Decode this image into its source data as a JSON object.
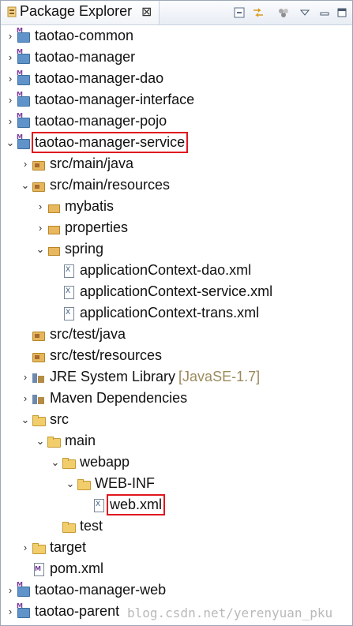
{
  "view": {
    "title": "Package Explorer",
    "close_glyph": "⊠"
  },
  "toolbar": {
    "icons": [
      "collapse-all-icon",
      "link-with-editor-icon",
      "focus-icon",
      "view-menu-icon",
      "minimize-icon",
      "maximize-icon"
    ]
  },
  "tree": [
    {
      "label": "taotao-common",
      "icon": "maven-project-icon",
      "expanded": false
    },
    {
      "label": "taotao-manager",
      "icon": "maven-project-icon",
      "expanded": false
    },
    {
      "label": "taotao-manager-dao",
      "icon": "maven-project-icon",
      "expanded": false
    },
    {
      "label": "taotao-manager-interface",
      "icon": "maven-project-icon",
      "expanded": false
    },
    {
      "label": "taotao-manager-pojo",
      "icon": "maven-project-icon",
      "expanded": false
    },
    {
      "label": "taotao-manager-service",
      "icon": "maven-project-icon",
      "expanded": true,
      "highlighted": true
    },
    {
      "label": "src/main/java",
      "icon": "source-folder-icon",
      "expanded": false
    },
    {
      "label": "src/main/resources",
      "icon": "source-folder-icon",
      "expanded": true
    },
    {
      "label": "mybatis",
      "icon": "package-icon",
      "expanded": false
    },
    {
      "label": "properties",
      "icon": "package-icon",
      "expanded": false
    },
    {
      "label": "spring",
      "icon": "package-icon",
      "expanded": true
    },
    {
      "label": "applicationContext-dao.xml",
      "icon": "xml-file-icon"
    },
    {
      "label": "applicationContext-service.xml",
      "icon": "xml-file-icon"
    },
    {
      "label": "applicationContext-trans.xml",
      "icon": "xml-file-icon"
    },
    {
      "label": "src/test/java",
      "icon": "source-folder-icon"
    },
    {
      "label": "src/test/resources",
      "icon": "source-folder-icon"
    },
    {
      "label": "JRE System Library",
      "decoration": "[JavaSE-1.7]",
      "icon": "library-icon",
      "expanded": false
    },
    {
      "label": "Maven Dependencies",
      "icon": "library-icon",
      "expanded": false
    },
    {
      "label": "src",
      "icon": "folder-icon",
      "expanded": true
    },
    {
      "label": "main",
      "icon": "folder-icon",
      "expanded": true
    },
    {
      "label": "webapp",
      "icon": "folder-icon",
      "expanded": true
    },
    {
      "label": "WEB-INF",
      "icon": "folder-icon",
      "expanded": true
    },
    {
      "label": "web.xml",
      "icon": "xml-file-icon",
      "highlighted": true
    },
    {
      "label": "test",
      "icon": "folder-icon"
    },
    {
      "label": "target",
      "icon": "folder-icon",
      "expanded": false
    },
    {
      "label": "pom.xml",
      "icon": "pom-file-icon"
    },
    {
      "label": "taotao-manager-web",
      "icon": "maven-project-icon",
      "expanded": false
    },
    {
      "label": "taotao-parent",
      "icon": "maven-project-icon",
      "expanded": false
    }
  ],
  "watermark": "blog.csdn.net/yerenyuan_pku"
}
